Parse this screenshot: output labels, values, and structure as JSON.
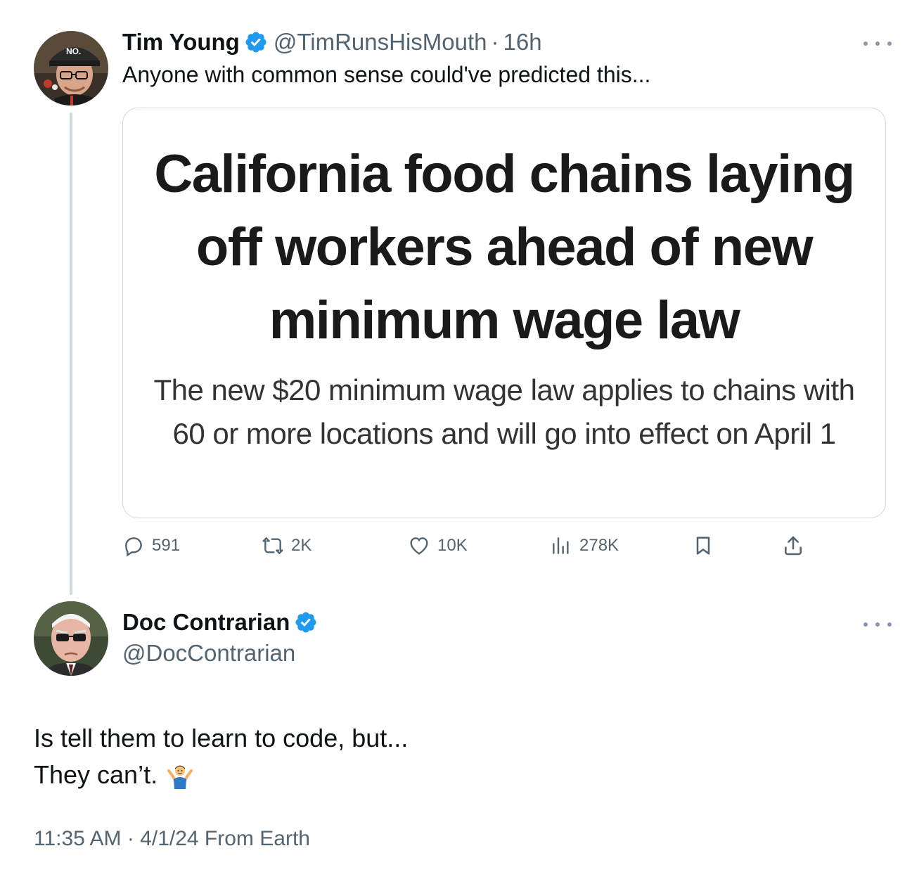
{
  "original_tweet": {
    "author_name": "Tim Young",
    "handle": "@TimRunsHisMouth",
    "separator": "·",
    "time": "16h",
    "text": "Anyone with common sense could've predicted this...",
    "card": {
      "headline": "California food chains laying off workers ahead of new minimum wage law",
      "subhead": "The new $20 minimum wage law applies to chains with 60 or more locations and will go into effect on April 1"
    },
    "actions": {
      "replies": "591",
      "reposts": "2K",
      "likes": "10K",
      "views": "278K"
    }
  },
  "reply_tweet": {
    "author_name": "Doc Contrarian",
    "handle": "@DocContrarian",
    "text_line1": "Is tell them to learn to code, but...",
    "text_line2": "They can’t.",
    "emoji": "man-shrugging",
    "timestamp": "11:35 AM · 4/1/24 From Earth"
  },
  "colors": {
    "text_primary": "#0f1419",
    "text_secondary": "#536471",
    "verified_blue": "#1d9bf0",
    "border": "#cfd9de"
  },
  "icons": [
    "verified-badge-icon",
    "more-icon",
    "reply-icon",
    "repost-icon",
    "like-icon",
    "views-icon",
    "bookmark-icon",
    "share-icon"
  ]
}
